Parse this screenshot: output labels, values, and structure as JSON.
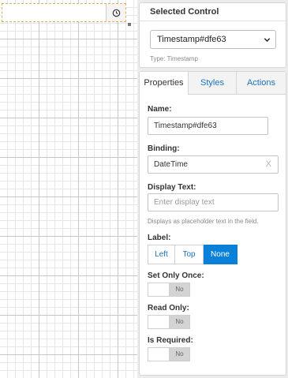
{
  "selected_control": {
    "heading": "Selected Control",
    "selected_value": "Timestamp#dfe63",
    "type_note": "Type: Timestamp"
  },
  "tabs": [
    {
      "label": "Properties",
      "active": true
    },
    {
      "label": "Styles",
      "active": false
    },
    {
      "label": "Actions",
      "active": false
    }
  ],
  "properties": {
    "name_label": "Name:",
    "name_value": "Timestamp#dfe63",
    "binding_label": "Binding:",
    "binding_value": "DateTime",
    "binding_clear": "X",
    "display_text_label": "Display Text:",
    "display_text_placeholder": "Enter display text",
    "display_text_help": "Displays as placeholder text in the field.",
    "label_label": "Label:",
    "label_options": [
      "Left",
      "Top",
      "None"
    ],
    "label_selected": "None",
    "set_only_once_label": "Set Only Once:",
    "set_only_once_value": "No",
    "read_only_label": "Read Only:",
    "read_only_value": "No",
    "is_required_label": "Is Required:",
    "is_required_value": "No"
  },
  "icons": {
    "timestamp_button": "clock-icon",
    "select_arrow": "chevron-down-icon"
  },
  "colors": {
    "accent": "#0a80d8",
    "link": "#1a73b8",
    "selection_outline": "#d9b15b"
  }
}
